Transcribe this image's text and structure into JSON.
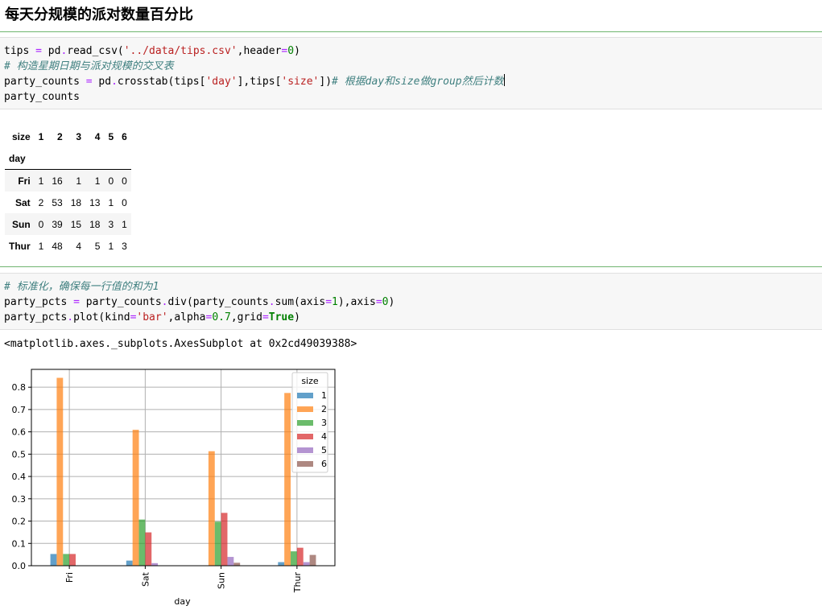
{
  "heading": "每天分规模的派对数量百分比",
  "cell1": {
    "lines": [
      [
        {
          "t": "tips "
        },
        {
          "t": "=",
          "c": "op"
        },
        {
          "t": " pd"
        },
        {
          "t": ".",
          "c": "op"
        },
        {
          "t": "read_csv("
        },
        {
          "t": "'../data/tips.csv'",
          "c": "str"
        },
        {
          "t": ",header"
        },
        {
          "t": "=",
          "c": "op"
        },
        {
          "t": "0",
          "c": "num"
        },
        {
          "t": ")"
        }
      ],
      [
        {
          "t": "# 构造星期日期与派对规模的交叉表",
          "c": "cm"
        }
      ],
      [
        {
          "t": "party_counts "
        },
        {
          "t": "=",
          "c": "op"
        },
        {
          "t": " pd"
        },
        {
          "t": ".",
          "c": "op"
        },
        {
          "t": "crosstab(tips["
        },
        {
          "t": "'day'",
          "c": "str"
        },
        {
          "t": "],tips["
        },
        {
          "t": "'size'",
          "c": "str"
        },
        {
          "t": "])"
        },
        {
          "t": "# 根据day和size做group然后计数",
          "c": "cm"
        }
      ],
      [
        {
          "t": "party_counts"
        }
      ]
    ]
  },
  "dataframe": {
    "columns_label": "size",
    "columns": [
      "1",
      "2",
      "3",
      "4",
      "5",
      "6"
    ],
    "index_label": "day",
    "rows": [
      {
        "idx": "Fri",
        "vals": [
          "1",
          "16",
          "1",
          "1",
          "0",
          "0"
        ]
      },
      {
        "idx": "Sat",
        "vals": [
          "2",
          "53",
          "18",
          "13",
          "1",
          "0"
        ]
      },
      {
        "idx": "Sun",
        "vals": [
          "0",
          "39",
          "15",
          "18",
          "3",
          "1"
        ]
      },
      {
        "idx": "Thur",
        "vals": [
          "1",
          "48",
          "4",
          "5",
          "1",
          "3"
        ]
      }
    ]
  },
  "cell2": {
    "lines": [
      [
        {
          "t": "# 标准化，确保每一行值的和为1",
          "c": "cm"
        }
      ],
      [
        {
          "t": "party_pcts "
        },
        {
          "t": "=",
          "c": "op"
        },
        {
          "t": " party_counts"
        },
        {
          "t": ".",
          "c": "op"
        },
        {
          "t": "div(party_counts"
        },
        {
          "t": ".",
          "c": "op"
        },
        {
          "t": "sum(axis"
        },
        {
          "t": "=",
          "c": "op"
        },
        {
          "t": "1",
          "c": "num"
        },
        {
          "t": "),axis"
        },
        {
          "t": "=",
          "c": "op"
        },
        {
          "t": "0",
          "c": "num"
        },
        {
          "t": ")"
        }
      ],
      [
        {
          "t": "party_pcts"
        },
        {
          "t": ".",
          "c": "op"
        },
        {
          "t": "plot(kind"
        },
        {
          "t": "=",
          "c": "op"
        },
        {
          "t": "'bar'",
          "c": "str"
        },
        {
          "t": ",alpha"
        },
        {
          "t": "=",
          "c": "op"
        },
        {
          "t": "0.7",
          "c": "num"
        },
        {
          "t": ",grid"
        },
        {
          "t": "=",
          "c": "op"
        },
        {
          "t": "True",
          "c": "kw"
        },
        {
          "t": ")"
        }
      ]
    ]
  },
  "output_text": "<matplotlib.axes._subplots.AxesSubplot at 0x2cd49039388>",
  "chart_data": {
    "type": "bar",
    "categories": [
      "Fri",
      "Sat",
      "Sun",
      "Thur"
    ],
    "xlabel": "day",
    "ylabel": "",
    "ylim": [
      0,
      0.88
    ],
    "yticks": [
      "0.0",
      "0.1",
      "0.2",
      "0.3",
      "0.4",
      "0.5",
      "0.6",
      "0.7",
      "0.8"
    ],
    "grid": true,
    "alpha": 0.7,
    "legend_title": "size",
    "legend_position": "top-right",
    "series": [
      {
        "name": "1",
        "color": "#1f77b4",
        "values": [
          0.0526,
          0.023,
          0.0,
          0.0161
        ]
      },
      {
        "name": "2",
        "color": "#ff7f0e",
        "values": [
          0.8421,
          0.6092,
          0.5132,
          0.7742
        ]
      },
      {
        "name": "3",
        "color": "#2ca02c",
        "values": [
          0.0526,
          0.2069,
          0.1974,
          0.0645
        ]
      },
      {
        "name": "4",
        "color": "#d62728",
        "values": [
          0.0526,
          0.1494,
          0.2368,
          0.0806
        ]
      },
      {
        "name": "5",
        "color": "#9467bd",
        "values": [
          0.0,
          0.0115,
          0.0395,
          0.0161
        ]
      },
      {
        "name": "6",
        "color": "#8c564b",
        "values": [
          0.0,
          0.0,
          0.0132,
          0.0484
        ]
      }
    ]
  }
}
